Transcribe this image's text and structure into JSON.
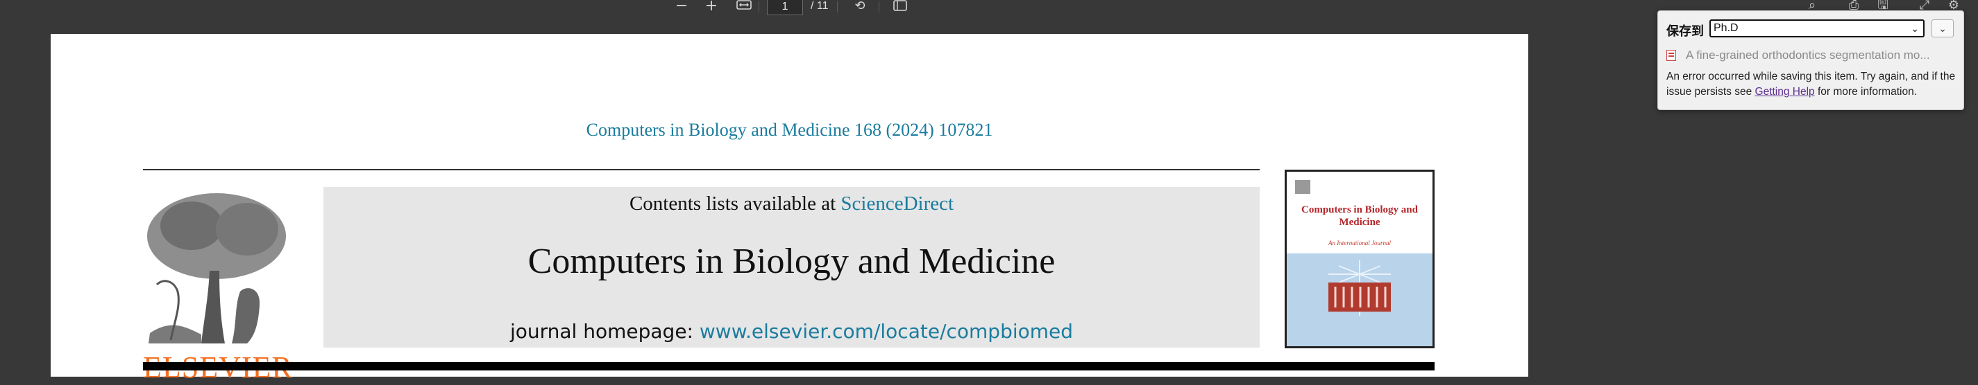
{
  "toolbar": {
    "zoom_out_icon": "minus-icon",
    "zoom_in_icon": "plus-icon",
    "page_input_value": "1",
    "page_total": "/ 11"
  },
  "pdf": {
    "journal_ref": "Computers in Biology and Medicine 168 (2024) 107821",
    "contents_prefix": "Contents lists available at",
    "contents_link": "ScienceDirect",
    "journal_title": "Computers in Biology and Medicine",
    "homepage_prefix": "journal homepage:",
    "homepage_url": "www.elsevier.com/locate/compbiomed",
    "publisher": "ELSEVIER",
    "cover_title": "Computers in Biology and Medicine",
    "cover_subtitle": "An International Journal"
  },
  "popup": {
    "save_label": "保存到",
    "target": "Ph.D",
    "item_title": "A fine-grained orthodontics segmentation mo...",
    "error_before": "An error occurred while saving this item. Try again, and if the issue persists see",
    "error_link": "Getting Help",
    "error_after": "for more information."
  },
  "colors": {
    "link_blue": "#1a7c9e",
    "elsevier_orange": "#f36f21",
    "toolbar_bg": "#383838"
  }
}
